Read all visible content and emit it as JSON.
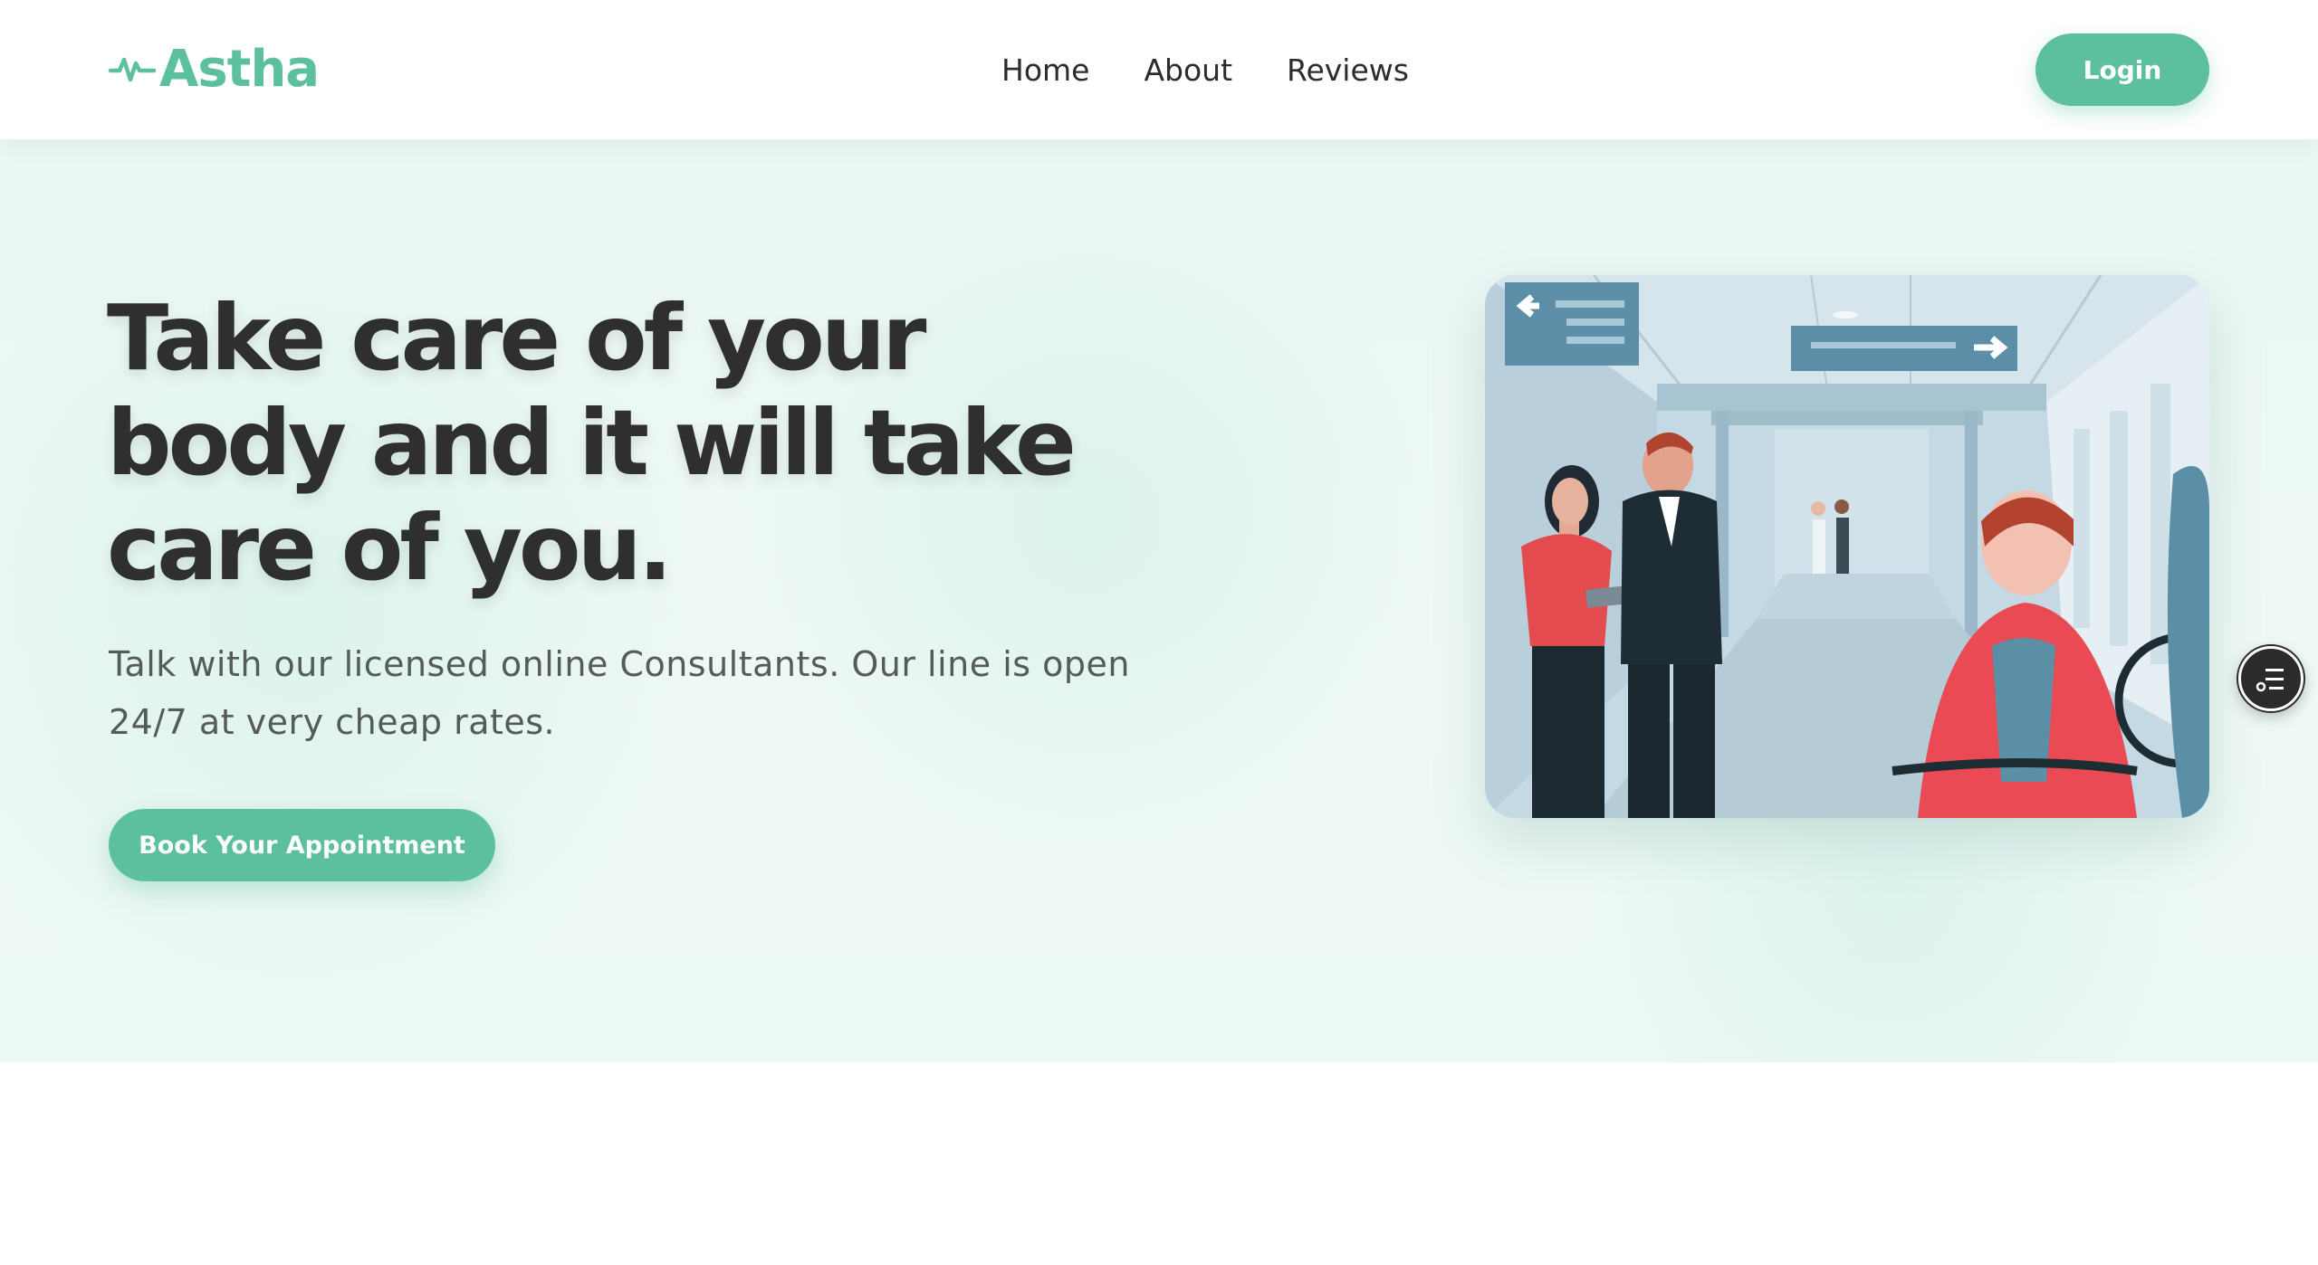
{
  "brand": {
    "name": "Astha",
    "icon": "pulse-icon",
    "color": "#5cc09c"
  },
  "nav": {
    "links": [
      {
        "label": "Home"
      },
      {
        "label": "About"
      },
      {
        "label": "Reviews"
      }
    ],
    "login_label": "Login"
  },
  "hero": {
    "title": "Take care of your body and it will take care of you.",
    "subtitle": "Talk with our licensed online Consultants. Our line is open 24/7 at very cheap rates.",
    "cta_label": "Book Your Appointment",
    "image_icon": "hospital-illustration"
  },
  "widget": {
    "icon": "checklist-icon"
  },
  "colors": {
    "accent": "#5cc09c",
    "heading": "#2f2f2f",
    "body_text": "#555a5a",
    "hero_bg": "#eaf7f5"
  }
}
